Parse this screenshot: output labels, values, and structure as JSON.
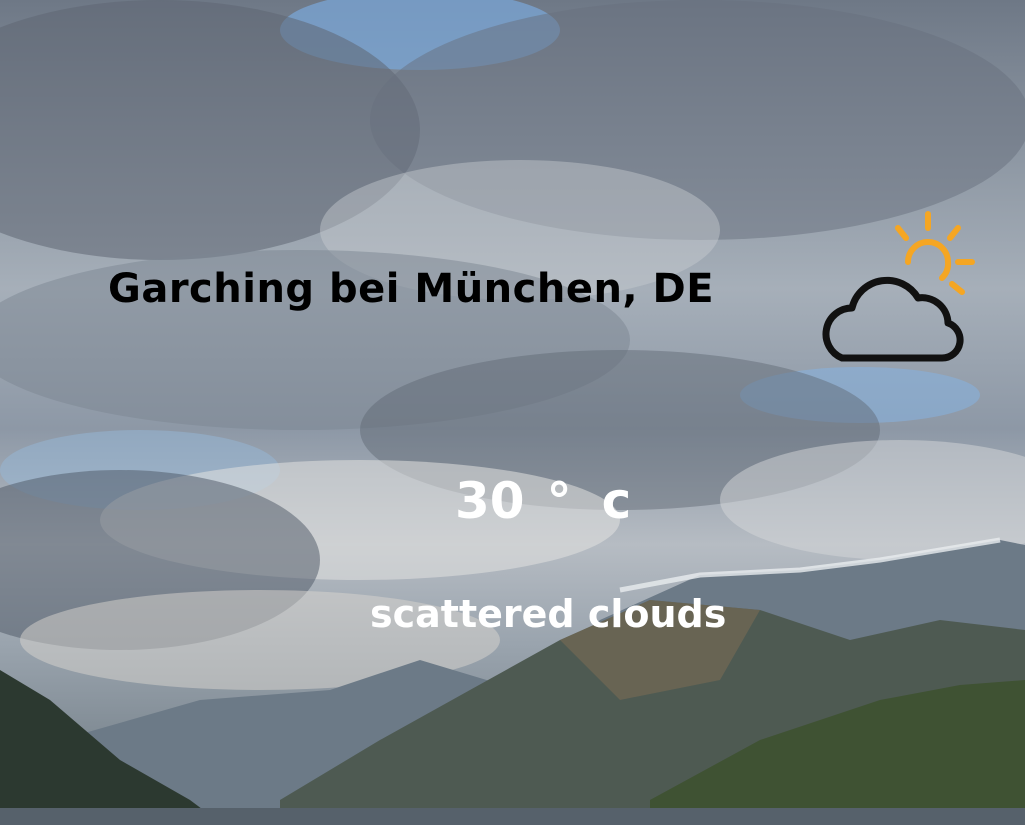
{
  "location": {
    "name": "Garching bei München, DE"
  },
  "weather": {
    "temperature": "30",
    "degree_symbol": "°",
    "unit": "c",
    "description": "scattered clouds",
    "icon": "partly-cloudy-icon"
  },
  "colors": {
    "text_dark": "#000000",
    "text_light": "#ffffff",
    "sun": "#f5a623",
    "cloud_outline": "#111111"
  }
}
